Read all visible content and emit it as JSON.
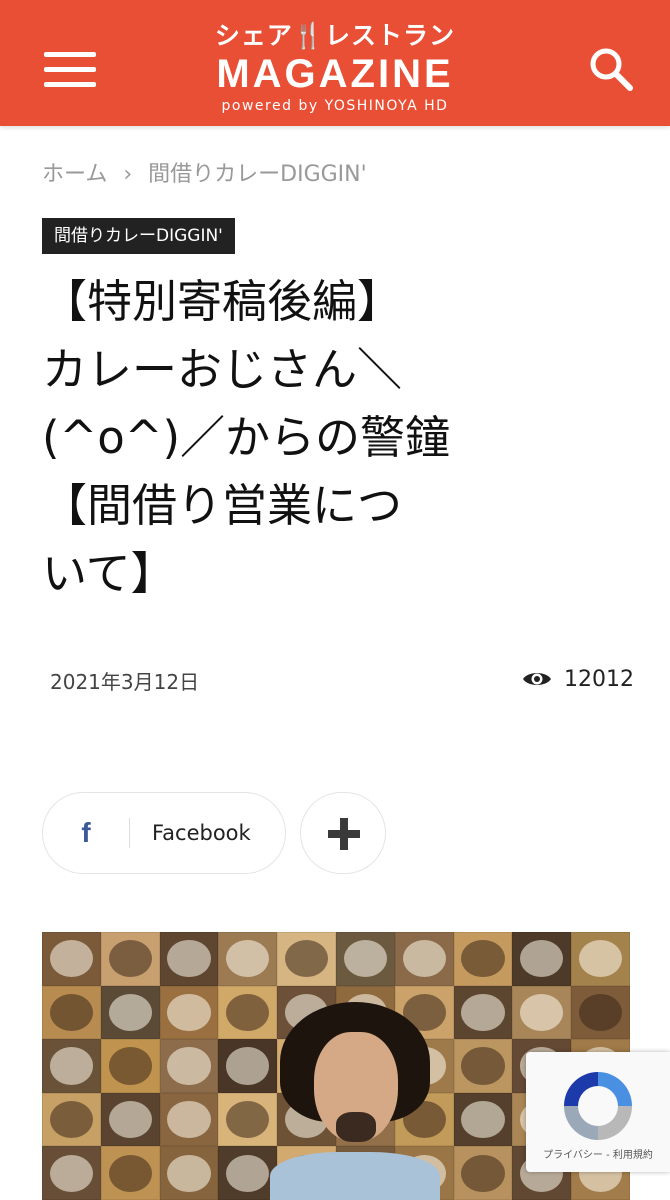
{
  "header": {
    "logo_top": "シェア🍴レストラン",
    "logo_main": "MAGAZINE",
    "logo_sub": "powered by YOSHINOYA HD",
    "background": "#e94f35",
    "menu_icon": "hamburger-menu-icon",
    "search_icon": "search-icon"
  },
  "breadcrumb": {
    "home": "ホーム",
    "separator": "›",
    "current": "間借りカレーDIGGIN'"
  },
  "article": {
    "category": "間借りカレーDIGGIN'",
    "title_lines": [
      "【特別寄稿後編】",
      "カレーおじさん＼",
      "(^o^)／からの警鐘",
      "【間借り営業につ",
      "いて】"
    ],
    "date": "2021年3月12日",
    "views": "12012",
    "views_icon": "eye-icon"
  },
  "share": {
    "facebook_icon": "f",
    "facebook_label": "Facebook",
    "more_icon": "plus-icon"
  },
  "recaptcha": {
    "text": "プライバシー - 利用規約"
  }
}
